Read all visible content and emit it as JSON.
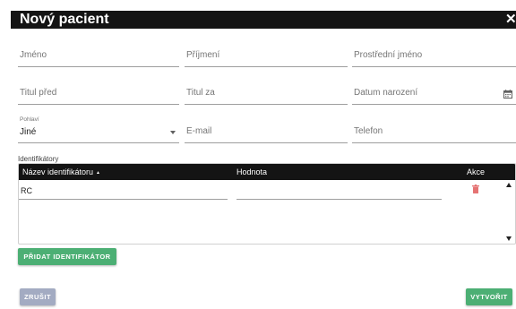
{
  "dialog": {
    "title": "Nový pacient",
    "close_icon": "close-icon"
  },
  "form": {
    "first_name": {
      "placeholder": "Jméno",
      "value": ""
    },
    "last_name": {
      "placeholder": "Příjmení",
      "value": ""
    },
    "middle_name": {
      "placeholder": "Prostřední jméno",
      "value": ""
    },
    "title_before": {
      "placeholder": "Titul před",
      "value": ""
    },
    "title_after": {
      "placeholder": "Titul za",
      "value": ""
    },
    "birth_date": {
      "placeholder": "Datum narození",
      "value": "",
      "icon": "calendar-icon"
    },
    "gender": {
      "label": "Pohlaví",
      "value": "Jiné"
    },
    "email": {
      "placeholder": "E-mail",
      "value": ""
    },
    "phone": {
      "placeholder": "Telefon",
      "value": ""
    }
  },
  "identifiers": {
    "section_label": "Identifikátory",
    "columns": [
      "Název identifikátoru",
      "Hodnota",
      "Akce"
    ],
    "sort_icon": "sort-ascending-icon",
    "rows": [
      {
        "name": "RC",
        "value": ""
      }
    ]
  },
  "buttons": {
    "add_identifier": "PŘIDAT IDENTIFIKÁTOR",
    "cancel": "ZRUŠIT",
    "create": "VYTVOŘIT"
  },
  "colors": {
    "titlebar": "#141414",
    "primary_green": "#4caf74",
    "cancel_gray": "#a3abc2",
    "delete_red": "#e57373"
  }
}
